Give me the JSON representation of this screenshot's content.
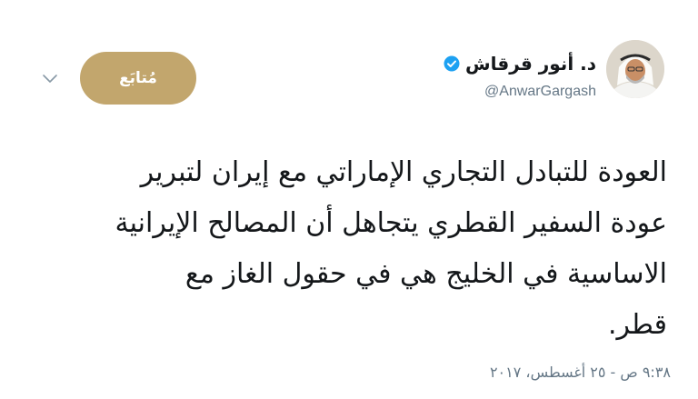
{
  "author": {
    "display_name": "د. أنور قرقاش",
    "handle": "@AnwarGargash",
    "verified": true,
    "avatar_icon": "person-portrait-icon"
  },
  "follow_button": {
    "label": "مُتابَع",
    "color": "#c2a66d"
  },
  "menu_icon": "chevron-down-icon",
  "tweet": {
    "lines": [
      "العودة للتبادل التجاري الإماراتي مع إيران لتبرير",
      "عودة السفير القطري يتجاهل أن المصالح الإيرانية",
      "الاساسية في الخليج هي في حقول الغاز مع",
      "قطر."
    ]
  },
  "timestamp": "٩:٣٨ ص - ٢٥ أغسطس، ٢٠١٧",
  "colors": {
    "text": "#14171a",
    "secondary_text": "#657786",
    "verified_blue": "#1da1f2"
  }
}
